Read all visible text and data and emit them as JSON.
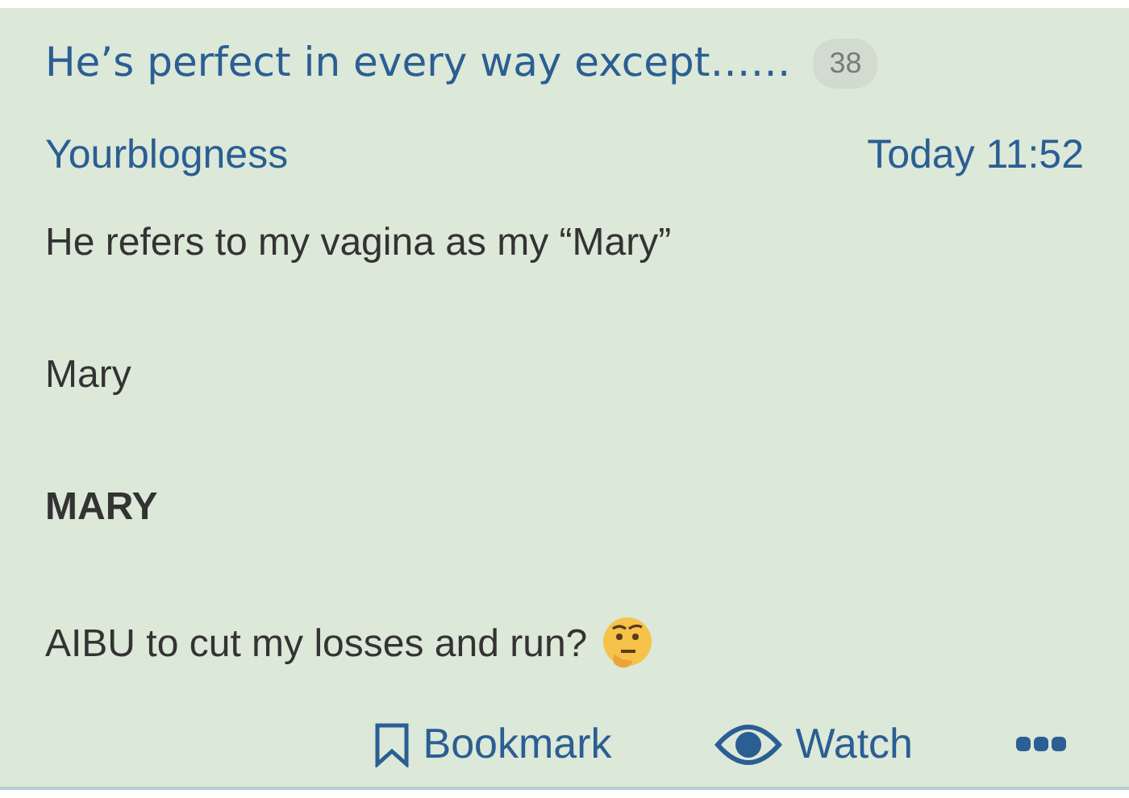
{
  "thread": {
    "title": "He’s perfect in every way except……",
    "reply_count": "38"
  },
  "post": {
    "author": "Yourblogness",
    "time": "Today 11:52",
    "paragraphs": [
      {
        "text": "He refers to my vagina as my “Mary”",
        "kind": "plain"
      },
      {
        "text": "Mary",
        "kind": "plain"
      },
      {
        "text": "MARY",
        "kind": "strong"
      },
      {
        "text": "AIBU to cut my losses and run?",
        "kind": "emoji_end"
      }
    ]
  },
  "actions": [
    {
      "label": "Bookmark",
      "kind": "bookmark"
    },
    {
      "label": "Watch",
      "kind": "watch"
    },
    {
      "kind": "more"
    }
  ]
}
